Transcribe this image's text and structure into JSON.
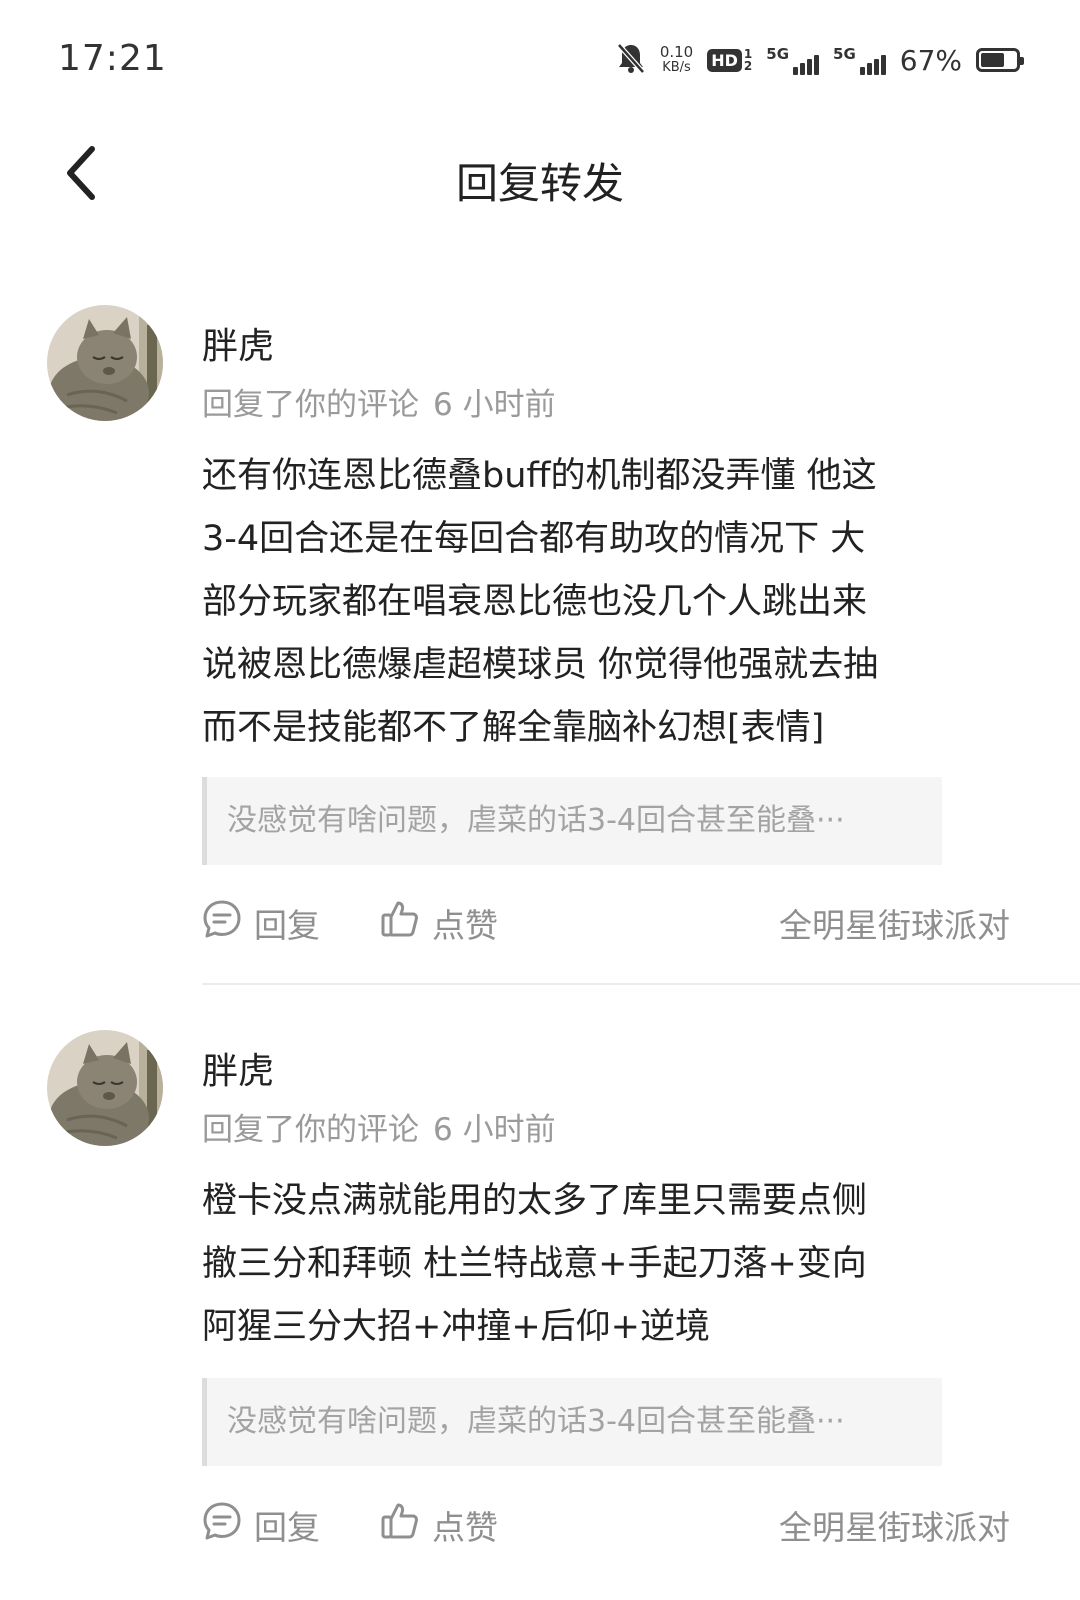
{
  "status_bar": {
    "time": "17:21",
    "net_speed_value": "0.10",
    "net_speed_unit": "KB/s",
    "hd_label": "HD",
    "hd_sim_top": "1",
    "hd_sim_bottom": "2",
    "signal1_label": "5G",
    "signal2_label": "5G",
    "battery_percent": "67%",
    "battery_level": 0.67,
    "icons": [
      "bell-muted-icon",
      "hd-icon",
      "signal-icon",
      "signal-icon",
      "battery-icon"
    ]
  },
  "header": {
    "title": "回复转发",
    "back_icon": "chevron-left-icon"
  },
  "notifications": [
    {
      "user_name": "胖虎",
      "action_text": "回复了你的评论",
      "time_ago": "6 小时前",
      "comment_lines": [
        "还有你连恩比德叠buff的机制都没弄懂 他这",
        "3-4回合还是在每回合都有助攻的情况下 大",
        "部分玩家都在唱衰恩比德也没几个人跳出来",
        "说被恩比德爆虐超模球员 你觉得他强就去抽",
        "而不是技能都不了解全靠脑补幻想[表情]"
      ],
      "quoted_text": "没感觉有啥问题，虐菜的话3-4回合甚至能叠···",
      "reply_label": "回复",
      "like_label": "点赞",
      "source": "全明星街球派对"
    },
    {
      "user_name": "胖虎",
      "action_text": "回复了你的评论",
      "time_ago": "6 小时前",
      "comment_lines": [
        "橙卡没点满就能用的太多了库里只需要点侧",
        "撤三分和拜顿 杜兰特战意+手起刀落+变向",
        "阿猩三分大招+冲撞+后仰+逆境"
      ],
      "quoted_text": "没感觉有啥问题，虐菜的话3-4回合甚至能叠···",
      "reply_label": "回复",
      "like_label": "点赞",
      "source": "全明星街球派对"
    }
  ]
}
